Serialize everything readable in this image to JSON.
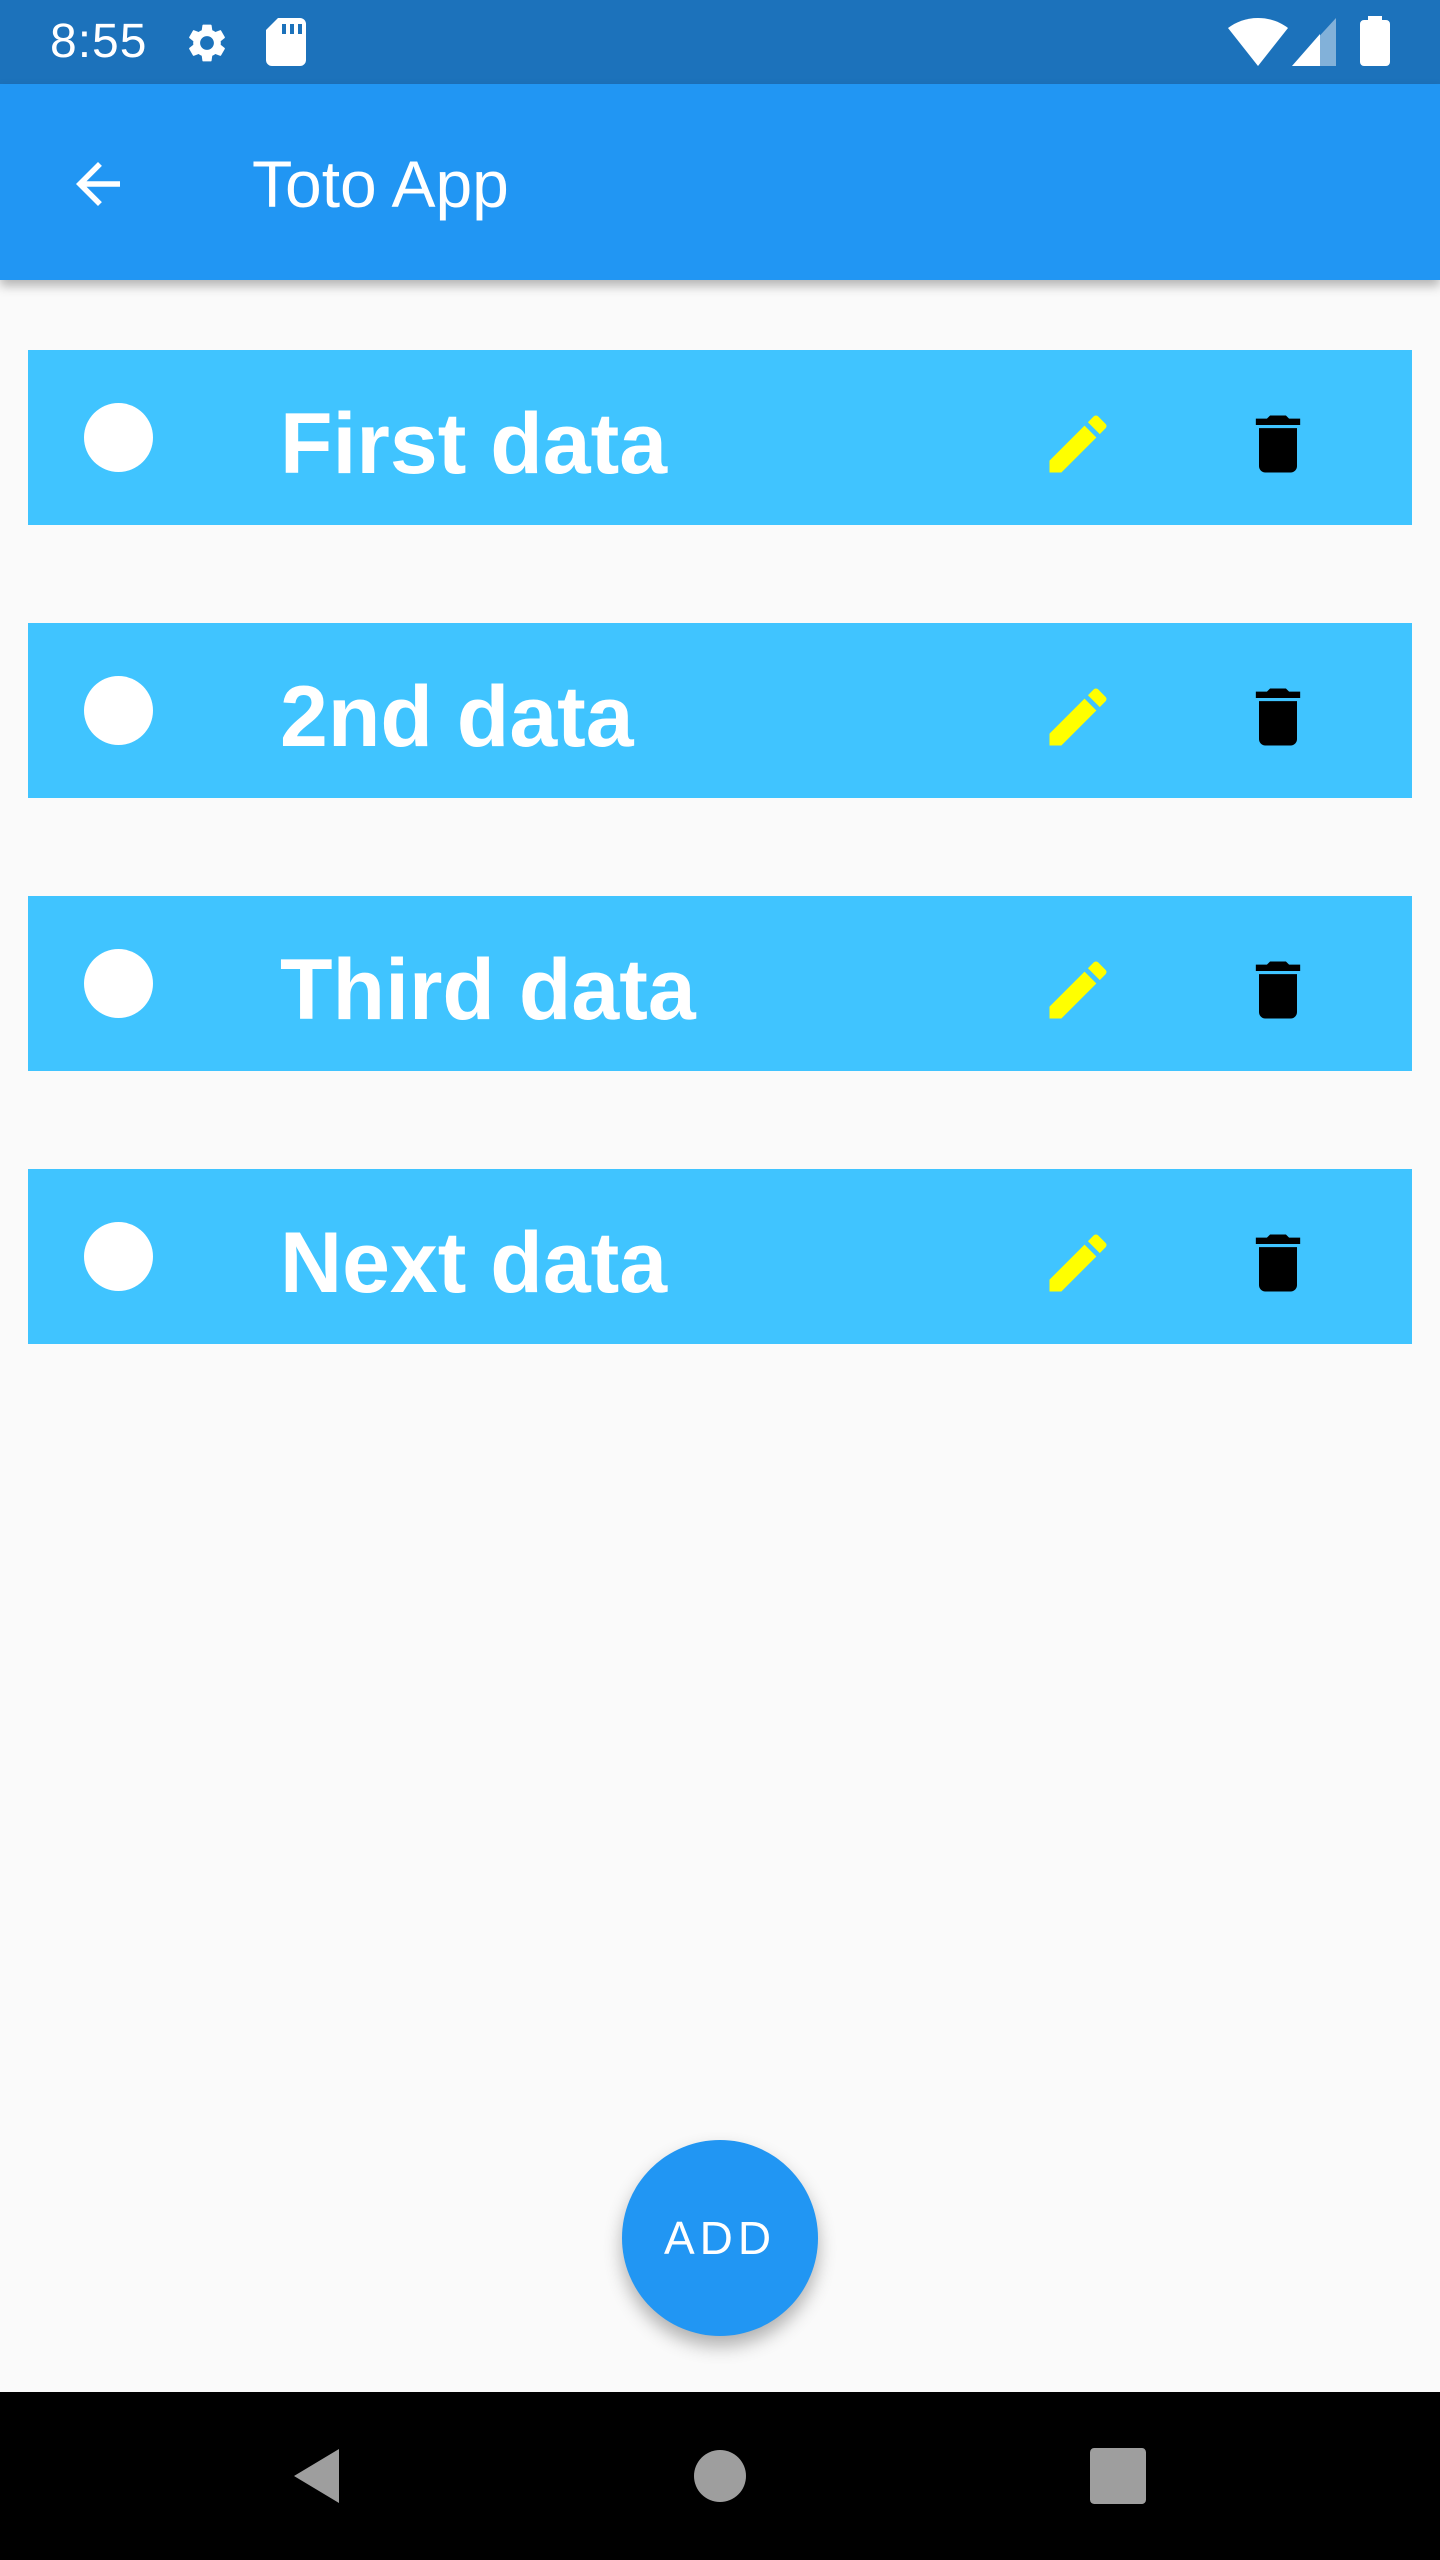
{
  "status_bar": {
    "time": "8:55",
    "icons": [
      "settings-icon",
      "sd-card-icon",
      "wifi-icon",
      "cell-signal-icon",
      "battery-icon"
    ]
  },
  "app_bar": {
    "title": "Toto App",
    "back_icon": "arrow-back-icon",
    "color": "#2196f3"
  },
  "items": [
    {
      "label": "First data",
      "checked": false
    },
    {
      "label": "2nd data",
      "checked": false
    },
    {
      "label": "Third data",
      "checked": false
    },
    {
      "label": "Next data",
      "checked": false
    }
  ],
  "item_style": {
    "background": "#40c4ff",
    "edit_icon": "pencil-icon",
    "edit_icon_color": "#ffff00",
    "delete_icon": "trash-icon",
    "delete_icon_color": "#000000"
  },
  "fab": {
    "label": "ADD",
    "color": "#2196f3"
  },
  "nav_bar": {
    "buttons": [
      "back-triangle-icon",
      "home-circle-icon",
      "recents-square-icon"
    ]
  }
}
